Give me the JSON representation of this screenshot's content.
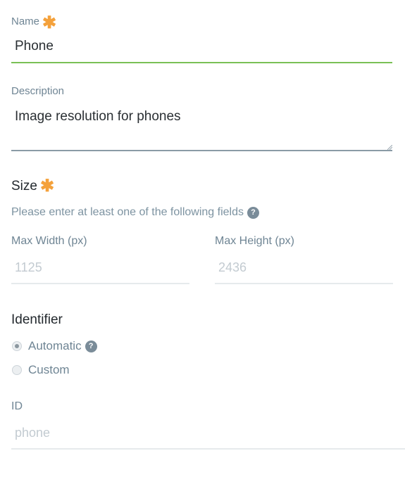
{
  "name_field": {
    "label": "Name",
    "required_mark": "✱",
    "value": "Phone",
    "underline_color": "#7ac055"
  },
  "description_field": {
    "label": "Description",
    "value": "Image resolution for phones"
  },
  "size_section": {
    "title": "Size",
    "required_mark": "✱",
    "help_text": "Please enter at least one of the following fields",
    "help_icon_glyph": "?",
    "max_width": {
      "label": "Max Width (px)",
      "placeholder": "1125"
    },
    "max_height": {
      "label": "Max Height (px)",
      "placeholder": "2436"
    }
  },
  "identifier_section": {
    "title": "Identifier",
    "options": [
      {
        "label": "Automatic",
        "selected": true,
        "has_help_icon": true
      },
      {
        "label": "Custom",
        "selected": false,
        "has_help_icon": false
      }
    ],
    "help_icon_glyph": "?"
  },
  "id_field": {
    "label": "ID",
    "placeholder": "phone"
  },
  "colors": {
    "required_star": "#f4a13b",
    "active_underline": "#7ac055",
    "label_text": "#6f8594",
    "help_icon_bg": "#7a8c99"
  }
}
